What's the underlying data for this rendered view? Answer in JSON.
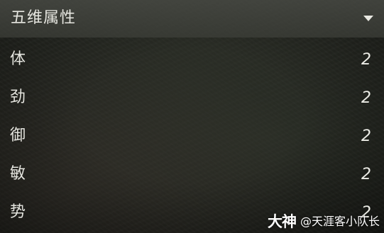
{
  "panel": {
    "title": "五维属性",
    "toggle_icon": "triangle-down-icon",
    "attributes": [
      {
        "label": "体",
        "value": "2"
      },
      {
        "label": "劲",
        "value": "2"
      },
      {
        "label": "御",
        "value": "2"
      },
      {
        "label": "敏",
        "value": "2"
      },
      {
        "label": "势",
        "value": "2"
      }
    ]
  },
  "watermark": {
    "logo": "大神",
    "author": "@天涯客小队长"
  },
  "colors": {
    "header_bg": "#4e504a",
    "text": "#e6e6e0",
    "background": "#1f211c"
  }
}
